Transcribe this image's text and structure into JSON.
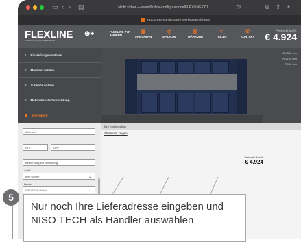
{
  "browser": {
    "url": "Nicht sicher — www.flexline-konfigurator.de/FLEXLINE-001",
    "tab_title": "FLEXLINE Konfigurator | Werkstatteinrichtung"
  },
  "logo": {
    "text": "FLEXLINE",
    "plus": "⊕+",
    "tagline": "WERKSTATT AUS EINER HAND"
  },
  "topnav": {
    "items": [
      {
        "label": "FLEXLINE-TYP ANDERN",
        "icon": ""
      },
      {
        "label": "SPEICHERN",
        "icon": "▣"
      },
      {
        "label": "SPRACHE",
        "icon": "◎"
      },
      {
        "label": "WÄHRUNG",
        "icon": "▤"
      },
      {
        "label": "TEILEN",
        "icon": "<"
      },
      {
        "label": "KONTAKT",
        "icon": "✆"
      }
    ]
  },
  "price_top": {
    "label": "Preis exkl. MwSt.",
    "value": "€ 4.924"
  },
  "sidebar": {
    "items": [
      {
        "num": "1",
        "label": "Einstellungen wählen"
      },
      {
        "num": "2",
        "label": "Modulen wählen"
      },
      {
        "num": "3",
        "label": "Zubehör wählen"
      },
      {
        "num": "4",
        "label": "Mehr Werkstatteinrichtung"
      },
      {
        "num": "",
        "label": "Warenkorb"
      }
    ]
  },
  "dims": {
    "w": "B 4840 mm",
    "h": "H 2100 mm",
    "t": "T 550 mm"
  },
  "form": {
    "adresse": "Adresse *",
    "plz": "PLZ *",
    "ort": "Ort *",
    "bemerkung": "Bemerkung zur Bestellung",
    "land_label": "Land *",
    "land_value": "Bitte Wählen",
    "haendler_label": "Händler",
    "haendler_value": "NISO TECH GmbH"
  },
  "config": {
    "head": "Ihre Konfiguration",
    "link": "Stückliste zeigen",
    "price_label": "Preis exkl. MwSt.",
    "price_value": "€ 4.924"
  },
  "step": {
    "number": "5"
  },
  "callout": {
    "text": "Nur noch Ihre Lieferadresse eingeben und NISO TECH als Händler auswählen"
  }
}
